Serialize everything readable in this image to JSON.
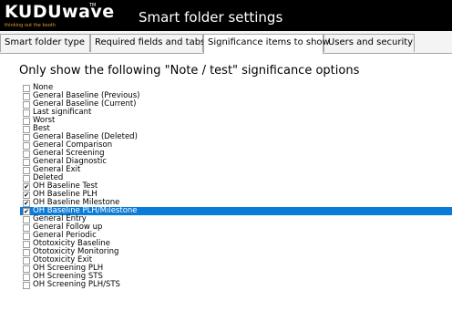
{
  "header": {
    "logo": "KUDUwave",
    "trademark": "TM",
    "tagline": "thinking out the booth",
    "title": "Smart folder settings"
  },
  "tabs": [
    {
      "label": "Smart folder type",
      "active": false
    },
    {
      "label": "Required fields and tabs",
      "active": false
    },
    {
      "label": "Significance items to show",
      "active": true
    },
    {
      "label": "Users and security",
      "active": false
    }
  ],
  "heading": "Only show the following \"Note / test\" significance options",
  "options": [
    {
      "label": "None",
      "checked": false
    },
    {
      "label": "General Baseline (Previous)",
      "checked": false
    },
    {
      "label": "General Baseline (Current)",
      "checked": false
    },
    {
      "label": "Last significant",
      "checked": false
    },
    {
      "label": "Worst",
      "checked": false
    },
    {
      "label": "Best",
      "checked": false
    },
    {
      "label": "General Baseline (Deleted)",
      "checked": false
    },
    {
      "label": "General Comparison",
      "checked": false
    },
    {
      "label": "General Screening",
      "checked": false
    },
    {
      "label": "General Diagnostic",
      "checked": false
    },
    {
      "label": "General Exit",
      "checked": false
    },
    {
      "label": "Deleted",
      "checked": false
    },
    {
      "label": "OH Baseline Test",
      "checked": true
    },
    {
      "label": "OH Baseline PLH",
      "checked": true
    },
    {
      "label": "OH Baseline Milestone",
      "checked": true
    },
    {
      "label": "OH Baseline PLH/Milestone",
      "checked": true,
      "selected": true
    },
    {
      "label": "General Entry",
      "checked": false
    },
    {
      "label": "General Follow up",
      "checked": false
    },
    {
      "label": "General Periodic",
      "checked": false
    },
    {
      "label": "Ototoxicity Baseline",
      "checked": false
    },
    {
      "label": "Ototoxicity Monitoring",
      "checked": false
    },
    {
      "label": "Ototoxicity Exit",
      "checked": false
    },
    {
      "label": "OH Screening PLH",
      "checked": false
    },
    {
      "label": "OH Screening STS",
      "checked": false
    },
    {
      "label": "OH Screening PLH/STS",
      "checked": false
    }
  ],
  "colors": {
    "header_bg": "#000000",
    "tagline": "#e39b2e",
    "selection": "#0a7cd8"
  }
}
